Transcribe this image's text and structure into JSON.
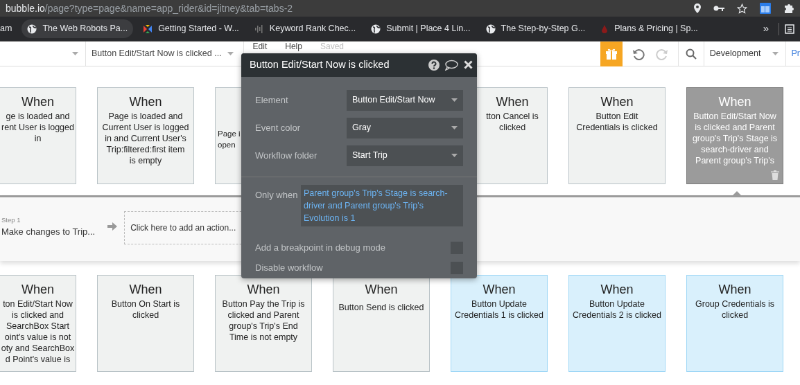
{
  "browser": {
    "url_host": "bubble.io",
    "url_path": "/page?type=page&name=app_rider&id=jitney&tab=tabs-2",
    "bookmarks": [
      {
        "label": "am",
        "hover": false
      },
      {
        "label": "The Web Robots Pa...",
        "hover": true
      },
      {
        "label": "Getting Started - W...",
        "hover": false
      },
      {
        "label": "Keyword Rank Chec...",
        "hover": false
      },
      {
        "label": "Submit | Place 4 Lin...",
        "hover": false
      },
      {
        "label": "The Step-by-Step G...",
        "hover": false
      },
      {
        "label": "Plans & Pricing | Sp...",
        "hover": false
      }
    ],
    "more": "»"
  },
  "toolbar": {
    "event_selector": "Button Edit/Start Now is clicked ...",
    "menus": [
      "Edit",
      "Help"
    ],
    "save_status": "Saved",
    "environment": "Development",
    "preview": "Pr"
  },
  "top_events": [
    {
      "kind": "full",
      "title": "When",
      "text": "ge is loaded and\nrent User is logged\nin",
      "color": "#f0f2f1",
      "selected": false
    },
    {
      "kind": "full",
      "title": "When",
      "text": "Page is loaded and\nCurrent User is logged\nin and Current User's\nTrip:filtered:first item\nis empty",
      "color": "#f0f2f1",
      "selected": false
    },
    {
      "kind": "clipped-right",
      "text": "Page i\nopen",
      "color": "#f0f2f1",
      "selected": false
    },
    {
      "kind": "clipped-left",
      "title": "When",
      "text": "tton Cancel is\nclicked",
      "color": "#f0f2f1",
      "selected": false
    },
    {
      "kind": "full",
      "title": "When",
      "text": "Button Edit\nCredentials is clicked",
      "color": "#f0f2f1",
      "selected": false
    },
    {
      "kind": "full",
      "title": "When",
      "text": "Button Edit/Start Now\nis clicked and Parent\ngroup's Trip's Stage is\nsearch-driver and\nParent group's Trip's",
      "color": "#9b9b9b",
      "selected": true
    }
  ],
  "actions": {
    "steps": [
      {
        "label": "Step 1",
        "text": "Make changes to Trip..."
      }
    ],
    "add_action": "Click here to add an action..."
  },
  "bottom_events": [
    {
      "kind": "full",
      "title": "When",
      "text": "ton Edit/Start Now\nis clicked and\nSearchBox Start\noint's value is not\noty and SearchBox\nd Point's value is",
      "color": "#f0f2f1",
      "selected": false
    },
    {
      "kind": "full",
      "title": "When",
      "text": "Button On Start is\nclicked",
      "color": "#f0f2f1",
      "selected": false
    },
    {
      "kind": "full",
      "title": "When",
      "text": "Button Pay the Trip is\nclicked and Parent\ngroup's Trip's End\nTime is not empty",
      "color": "#f0f2f1",
      "selected": false
    },
    {
      "kind": "full",
      "title": "When",
      "text": "Button Send is clicked",
      "color": "#f0f2f1",
      "selected": false
    },
    {
      "kind": "full",
      "title": "When",
      "text": "Button Update\nCredentials 1 is clicked",
      "color": "#d9f0fc",
      "selected": false
    },
    {
      "kind": "full",
      "title": "When",
      "text": "Button Update\nCredentials 2 is clicked",
      "color": "#d9f0fc",
      "selected": false
    },
    {
      "kind": "full",
      "title": "When",
      "text": "Group Credentials is\nclicked",
      "color": "#d9f0fc",
      "selected": false
    }
  ],
  "popup": {
    "title": "Button Edit/Start Now is clicked",
    "fields": [
      {
        "label": "Element",
        "value": "Button Edit/Start Now"
      },
      {
        "label": "Event color",
        "value": "Gray"
      },
      {
        "label": "Workflow folder",
        "value": "Start Trip"
      }
    ],
    "only_when": {
      "label": "Only when",
      "value": "Parent group's Trip's Stage is search-driver and Parent group's Trip's Evolution is 1"
    },
    "options": [
      {
        "label": "Add a breakpoint in debug mode",
        "checked": false
      },
      {
        "label": "Disable workflow",
        "checked": false
      }
    ]
  }
}
